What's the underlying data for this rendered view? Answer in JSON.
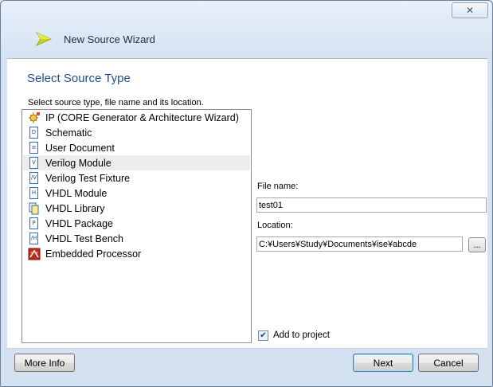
{
  "window": {
    "title": "New Source Wizard",
    "close_label": "✕"
  },
  "section": {
    "title": "Select Source Type",
    "instruction": "Select source type, file name and its location."
  },
  "source_types": [
    {
      "label": "IP (CORE Generator & Architecture Wizard)",
      "icon": "ip-core-icon",
      "selected": false
    },
    {
      "label": "Schematic",
      "icon": "schematic-icon",
      "selected": false
    },
    {
      "label": "User Document",
      "icon": "user-document-icon",
      "selected": false
    },
    {
      "label": "Verilog Module",
      "icon": "verilog-module-icon",
      "selected": true
    },
    {
      "label": "Verilog Test Fixture",
      "icon": "verilog-test-fixture-icon",
      "selected": false
    },
    {
      "label": "VHDL Module",
      "icon": "vhdl-module-icon",
      "selected": false
    },
    {
      "label": "VHDL Library",
      "icon": "vhdl-library-icon",
      "selected": false
    },
    {
      "label": "VHDL Package",
      "icon": "vhdl-package-icon",
      "selected": false
    },
    {
      "label": "VHDL Test Bench",
      "icon": "vhdl-test-bench-icon",
      "selected": false
    },
    {
      "label": "Embedded Processor",
      "icon": "embedded-processor-icon",
      "selected": false
    }
  ],
  "file_name": {
    "label": "File name:",
    "value": "test01"
  },
  "location": {
    "label": "Location:",
    "value": "C:¥Users¥Study¥Documents¥ise¥abcde",
    "browse_label": "..."
  },
  "add_to_project": {
    "label": "Add to project",
    "checked": true,
    "check_glyph": "✔"
  },
  "buttons": {
    "more_info": "More Info",
    "next": "Next",
    "cancel": "Cancel"
  },
  "colors": {
    "accent_title": "#1f4e8c",
    "selection": "#ececec",
    "frame": "#d6e3f3"
  }
}
